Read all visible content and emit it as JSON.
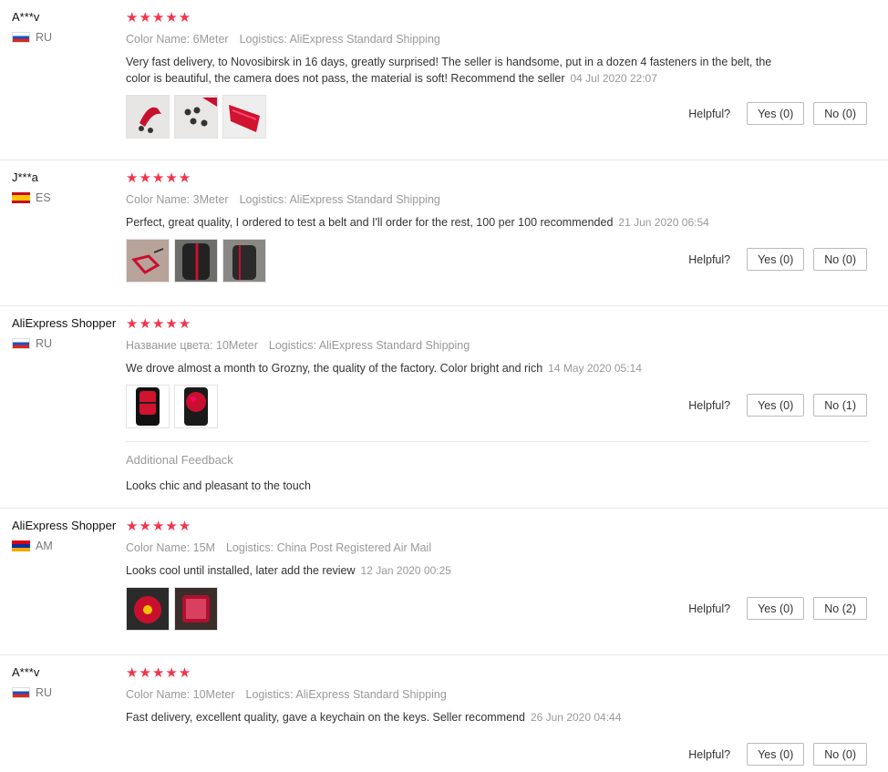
{
  "labels": {
    "helpful": "Helpful?",
    "logistics": "Logistics:",
    "additional_feedback": "Additional Feedback"
  },
  "stars": "★★★★★",
  "reviews": [
    {
      "user": "A***v",
      "country": "RU",
      "flag": "ru",
      "color_label": "Color Name:",
      "color": "6Meter",
      "logistics": "AliExpress Standard Shipping",
      "text": "Very fast delivery, to Novosibirsk in 16 days, greatly surprised! The seller is handsome, put in a dozen 4 fasteners in the belt, the color is beautiful, the camera does not pass, the material is soft! Recommend the seller",
      "date": "04 Jul 2020 22:07",
      "yes": "Yes (0)",
      "no": "No (0)",
      "photos": 3
    },
    {
      "user": "J***a",
      "country": "ES",
      "flag": "es",
      "color_label": "Color Name:",
      "color": "3Meter",
      "logistics": "AliExpress Standard Shipping",
      "text": "Perfect, great quality, I ordered to test a belt and I'll order for the rest, 100 per 100 recommended",
      "date": "21 Jun 2020 06:54",
      "yes": "Yes (0)",
      "no": "No (0)",
      "photos": 3
    },
    {
      "user": "AliExpress Shopper",
      "country": "RU",
      "flag": "ru",
      "color_label": "Название цвета:",
      "color": "10Meter",
      "logistics": "AliExpress Standard Shipping",
      "text": "We drove almost a month to Grozny, the quality of the factory. Color bright and rich",
      "date": "14 May 2020 05:14",
      "yes": "Yes (0)",
      "no": "No (1)",
      "photos": 2,
      "additional_feedback": "Looks chic and pleasant to the touch"
    },
    {
      "user": "AliExpress Shopper",
      "country": "AM",
      "flag": "am",
      "color_label": "Color Name:",
      "color": "15M",
      "logistics": "China Post Registered Air Mail",
      "text": "Looks cool until installed, later add the review",
      "date": "12 Jan 2020 00:25",
      "yes": "Yes (0)",
      "no": "No (2)",
      "photos": 2
    },
    {
      "user": "A***v",
      "country": "RU",
      "flag": "ru",
      "color_label": "Color Name:",
      "color": "10Meter",
      "logistics": "AliExpress Standard Shipping",
      "text": "Fast delivery, excellent quality, gave a keychain on the keys. Seller recommend",
      "date": "26 Jun 2020 04:44",
      "yes": "Yes (0)",
      "no": "No (0)",
      "photos": 0
    }
  ]
}
